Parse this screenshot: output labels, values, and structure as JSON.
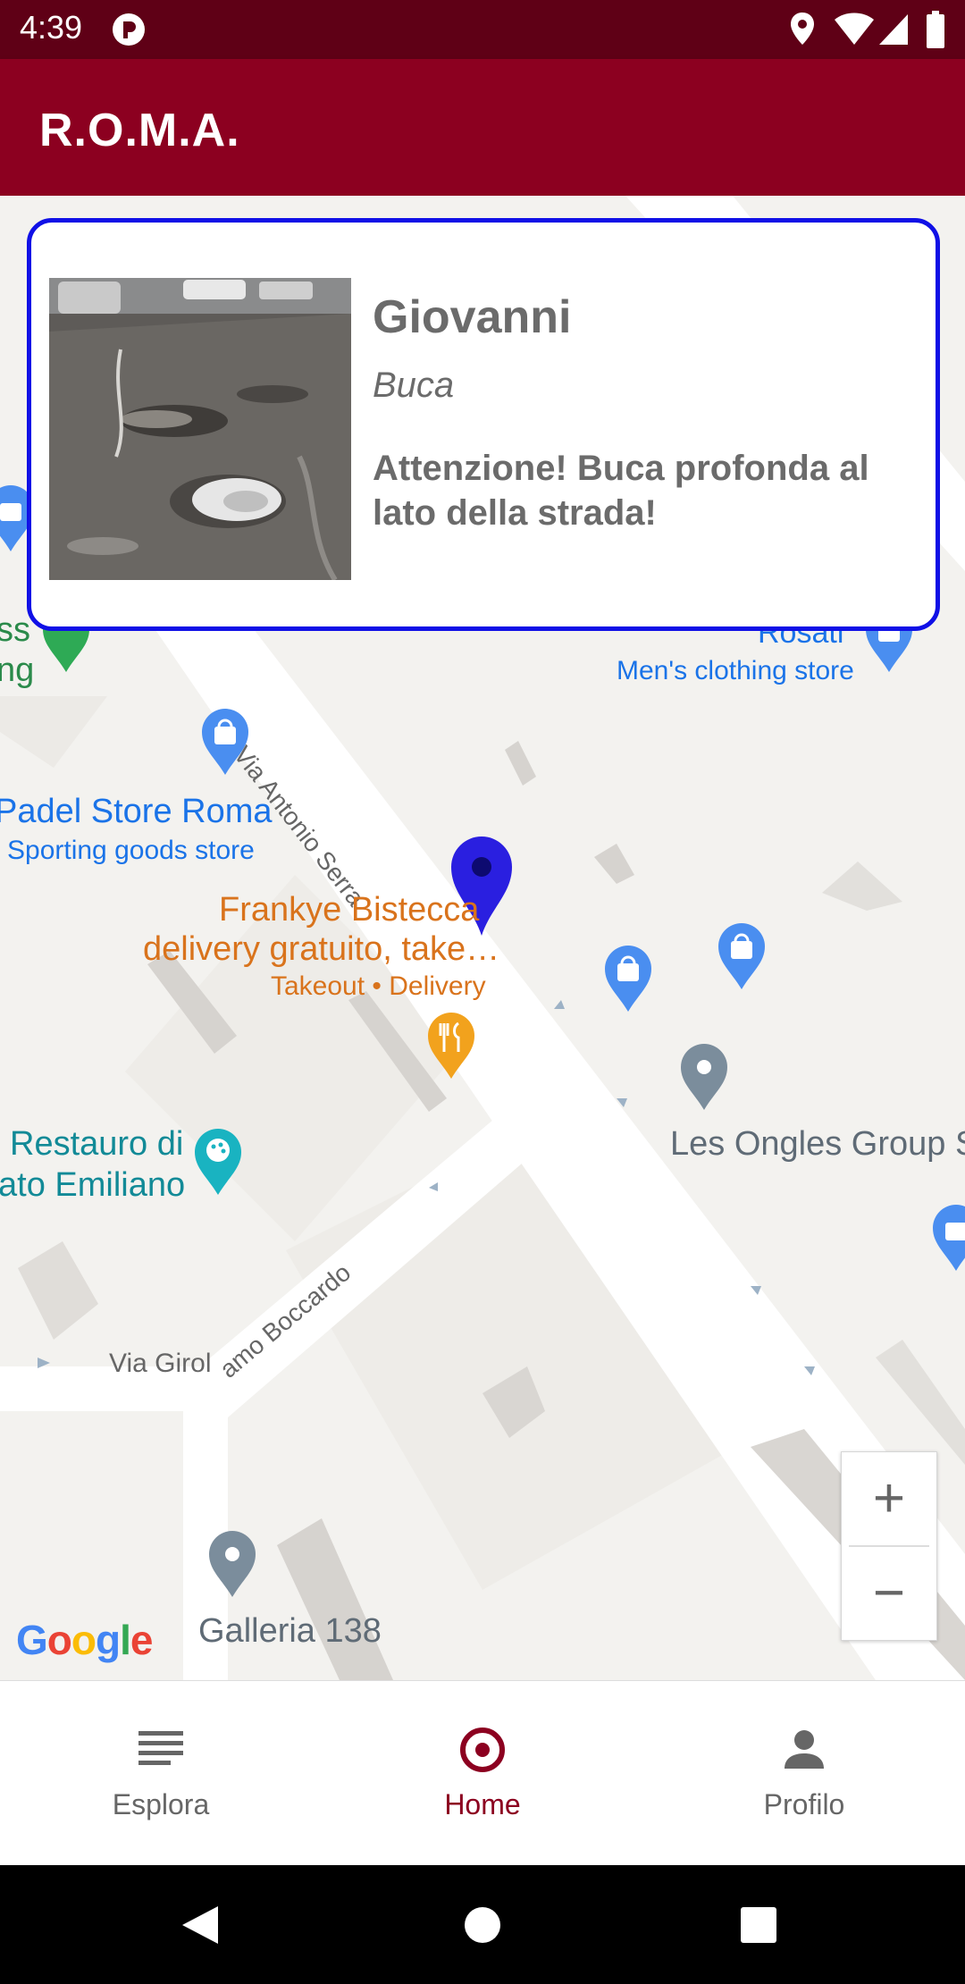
{
  "status_bar": {
    "time": "4:39"
  },
  "app_bar": {
    "title": "R.O.M.A."
  },
  "report_card": {
    "name": "Giovanni",
    "category": "Buca",
    "description": "Attenzione! Buca profonda al lato della strada!"
  },
  "map_labels": {
    "store_rosati": "Rosati",
    "mens_clothing": "Men's clothing store",
    "street_antonio_serra": "Via Antonio Serra",
    "padel_store": "Padel Store Roma",
    "sporting_goods": "Sporting goods store",
    "frankye_line1": "Frankye Bistecca",
    "frankye_line2": "delivery gratuito, take…",
    "frankye_sub": "Takeout • Delivery",
    "restauro_line1": "l Restauro di",
    "restauro_line2": "ato Emiliano",
    "les_ongles": "Les Ongles Group S",
    "street_boccardo_a": "Via Girol",
    "street_boccardo_b": "amo Boccardo",
    "galleria": "Galleria 138",
    "partial_left_1": "ss",
    "partial_left_2": "ng"
  },
  "map_controls": {
    "zoom_in": "+",
    "zoom_out": "−",
    "google_logo": "Google"
  },
  "bottom_nav": {
    "items": [
      {
        "label": "Esplora",
        "icon": "list-icon",
        "active": false
      },
      {
        "label": "Home",
        "icon": "location-target-icon",
        "active": true
      },
      {
        "label": "Profilo",
        "icon": "person-icon",
        "active": false
      }
    ]
  },
  "colors": {
    "primary": "#8c0020",
    "status_bar": "#5f0016",
    "card_border": "#1010e6",
    "pin": "#2a1fe0"
  }
}
